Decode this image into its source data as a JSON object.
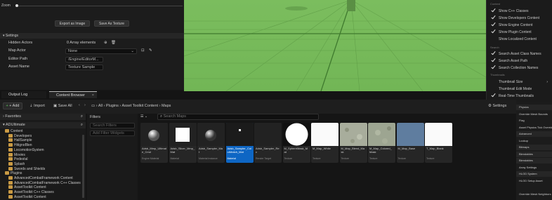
{
  "details": {
    "zoom_label": "Zoom",
    "export_button": "Export as Image",
    "save_button": "Save As Texture",
    "settings_header": "Settings",
    "rows": [
      {
        "label": "Hidden Actors",
        "value": "0 Array elements"
      },
      {
        "label": "Map Actor",
        "value": "None"
      },
      {
        "label": "Editor Path",
        "value": "/Engine/EditorM..."
      },
      {
        "label": "Asset Name",
        "value": "Texture Sample"
      }
    ]
  },
  "view_options": {
    "sections": [
      {
        "header": "Content",
        "items": [
          {
            "label": "Show C++ Classes",
            "checked": true
          },
          {
            "label": "Show Developers Content",
            "checked": true
          },
          {
            "label": "Show Engine Content",
            "checked": true
          },
          {
            "label": "Show Plugin Content",
            "checked": true
          },
          {
            "label": "Show Localized Content",
            "checked": false
          }
        ]
      },
      {
        "header": "Search",
        "items": [
          {
            "label": "Search Asset Class Names",
            "checked": true
          },
          {
            "label": "Search Asset Path",
            "checked": true
          },
          {
            "label": "Search Collection Names",
            "checked": true
          }
        ]
      },
      {
        "header": "Thumbnails",
        "items": [
          {
            "label": "Thumbnail Size",
            "checked": false,
            "arrow": true
          },
          {
            "label": "Thumbnail Edit Mode",
            "checked": false
          },
          {
            "label": "Real-Time Thumbnails",
            "checked": true
          }
        ]
      }
    ]
  },
  "tabs": {
    "output_log": "Output Log",
    "content_browser": "Content Browser"
  },
  "toolbar": {
    "add": "+ Add",
    "import": "Import",
    "save_all": "Save All",
    "breadcrumb": [
      "All",
      "Plugins",
      "Asset Toolkit Content",
      "Maps"
    ],
    "settings": "Settings",
    "search_placeholder": "Search Maps"
  },
  "sources": {
    "favorites": "Favorites",
    "project": "ADUltimate",
    "tree": [
      {
        "label": "Content",
        "depth": 1
      },
      {
        "label": "Developers",
        "depth": 2
      },
      {
        "label": "HallSample",
        "depth": 2
      },
      {
        "label": "HitignoBlen",
        "depth": 2
      },
      {
        "label": "LocomotionSystem",
        "depth": 2
      },
      {
        "label": "Movies",
        "depth": 2
      },
      {
        "label": "Pedestal",
        "depth": 2
      },
      {
        "label": "Splash",
        "depth": 2
      },
      {
        "label": "Swords and Shields",
        "depth": 2
      },
      {
        "label": "Plugins",
        "depth": 1
      },
      {
        "label": "AdvancedCombatFramework Content",
        "depth": 2
      },
      {
        "label": "AdvancedCombatFramework C++ Classes",
        "depth": 2
      },
      {
        "label": "AssetToolkit Content",
        "depth": 2
      },
      {
        "label": "AssetToolkit C++ Classes",
        "depth": 2
      },
      {
        "label": "AssetToolkit Content",
        "depth": 2
      }
    ]
  },
  "filters": {
    "title": "Filters",
    "search": "Search Filters",
    "add": "Add Filter Widgets"
  },
  "assets": [
    {
      "name": "Adsb_Mmp_Ultimate_Cmd",
      "type": "Engine Material",
      "thumb": "sphere"
    },
    {
      "name": "Adsb_Slicer_Mmp_Mat",
      "type": "Material",
      "thumb": "white-square"
    },
    {
      "name": "Adsb_Sampler_Mat",
      "type": "Material Instance",
      "thumb": "sphere2"
    },
    {
      "name": "Adsb_Sampler_ColorMatch_Mat",
      "type": "Material",
      "thumb": "dot",
      "selected": true
    },
    {
      "name": "Adsb_Sampler_Rec",
      "type": "Render Target",
      "thumb": "dark"
    },
    {
      "name": "M_SphereMask_Mat",
      "type": "Texture",
      "thumb": "circle"
    },
    {
      "name": "M_Map_White",
      "type": "Texture",
      "thumb": "white"
    },
    {
      "name": "M_Map_Blend_Mask",
      "type": "Texture",
      "thumb": "noise"
    },
    {
      "name": "M_Map_Colored_Mask",
      "type": "Texture",
      "thumb": "noise2"
    },
    {
      "name": "M_Map_Base",
      "type": "Texture",
      "thumb": "blue"
    },
    {
      "name": "T_Map_Blank",
      "type": "Texture",
      "thumb": "white"
    }
  ],
  "right_panel": {
    "rows": [
      "Physics",
      "Override Mesh Bounds",
      "Flag",
      "Asset Physics Tick Override",
      "Advanced",
      "Lookup",
      "Bitmaps",
      "Blendables",
      "Blendables",
      "Array Settings",
      "HLOD System",
      "HLOD Setup Asset",
      "",
      "Override Mesh Neighbors"
    ]
  }
}
